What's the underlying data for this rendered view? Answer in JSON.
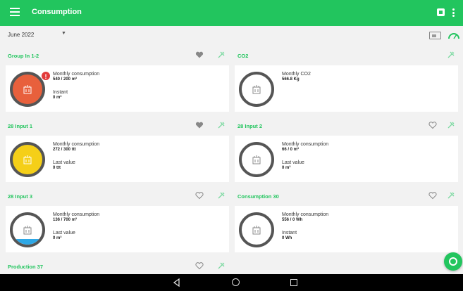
{
  "appbar": {
    "title": "Consumption",
    "menu_icon": "menu-icon",
    "bookmark_icon": "bookmark-icon",
    "more_icon": "more-vert-icon"
  },
  "filter": {
    "month": "June 2022"
  },
  "colors": {
    "primary": "#22c55e",
    "alert": "#e23b3b",
    "yellow": "#f5cf18",
    "red_fill": "#e8603c",
    "water_blue": "#2ea8e6"
  },
  "cards": [
    {
      "name": "Group In 1-2",
      "favorite": true,
      "label1": "Monthly consumption",
      "value1": "540 / 200  m³",
      "label2": "Instant",
      "value2": "0  m³",
      "gauge": "red",
      "alert": "!"
    },
    {
      "name": "CO2",
      "favorite": null,
      "label1": "Monthly CO2",
      "value1": "566.8   Kg",
      "label2": "",
      "value2": "",
      "gauge": "empty"
    },
    {
      "name": "28 Input 1",
      "favorite": true,
      "label1": "Monthly consumption",
      "value1": "272 / 300  ttt",
      "label2": "Last value",
      "value2": "0  ttt",
      "gauge": "yellow"
    },
    {
      "name": "28 Input 2",
      "favorite": false,
      "label1": "Monthly consumption",
      "value1": "66 / 0    m³",
      "label2": "Last value",
      "value2": "0  m³",
      "gauge": "empty"
    },
    {
      "name": "28 Input 3",
      "favorite": false,
      "label1": "Monthly consumption",
      "value1": "136 / 700  m³",
      "label2": "Last value",
      "value2": "0  m³",
      "gauge": "blue",
      "level": 0.19
    },
    {
      "name": "Consumption 30",
      "favorite": false,
      "label1": "Monthly consumption",
      "value1": "556 / 0  Wh",
      "label2": "Instant",
      "value2": "0  Wh",
      "gauge": "empty"
    },
    {
      "name": "Production 37",
      "favorite": false
    }
  ]
}
